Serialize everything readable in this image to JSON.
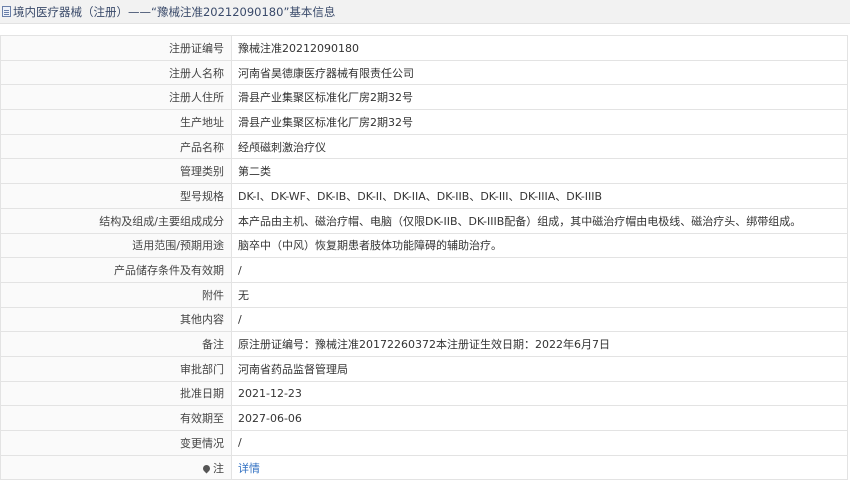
{
  "header": {
    "title": "境内医疗器械（注册）——“豫械注准20212090180”基本信息"
  },
  "rows": [
    {
      "label": "注册证编号",
      "value": "豫械注准20212090180"
    },
    {
      "label": "注册人名称",
      "value": "河南省昊德康医疗器械有限责任公司"
    },
    {
      "label": "注册人住所",
      "value": "滑县产业集聚区标准化厂房2期32号"
    },
    {
      "label": "生产地址",
      "value": "滑县产业集聚区标准化厂房2期32号"
    },
    {
      "label": "产品名称",
      "value": "经颅磁刺激治疗仪"
    },
    {
      "label": "管理类别",
      "value": "第二类"
    },
    {
      "label": "型号规格",
      "value": "DK-I、DK-WF、DK-IB、DK-II、DK-IIA、DK-IIB、DK-III、DK-IIIA、DK-IIIB"
    },
    {
      "label": "结构及组成/主要组成成分",
      "value": "本产品由主机、磁治疗帽、电脑（仅限DK-IIB、DK-IIIB配备）组成，其中磁治疗帽由电极线、磁治疗头、绑带组成。"
    },
    {
      "label": "适用范围/预期用途",
      "value": "脑卒中（中风）恢复期患者肢体功能障碍的辅助治疗。"
    },
    {
      "label": "产品储存条件及有效期",
      "value": "/"
    },
    {
      "label": "附件",
      "value": "无"
    },
    {
      "label": "其他内容",
      "value": "/"
    },
    {
      "label": "备注",
      "value": "原注册证编号：豫械注准20172260372本注册证生效日期：2022年6月7日"
    },
    {
      "label": "审批部门",
      "value": "河南省药品监督管理局"
    },
    {
      "label": "批准日期",
      "value": "2021-12-23"
    },
    {
      "label": "有效期至",
      "value": "2027-06-06"
    },
    {
      "label": "变更情况",
      "value": "/"
    }
  ],
  "note_row": {
    "icon": "pin-icon",
    "label": "注",
    "link_text": "详情"
  }
}
